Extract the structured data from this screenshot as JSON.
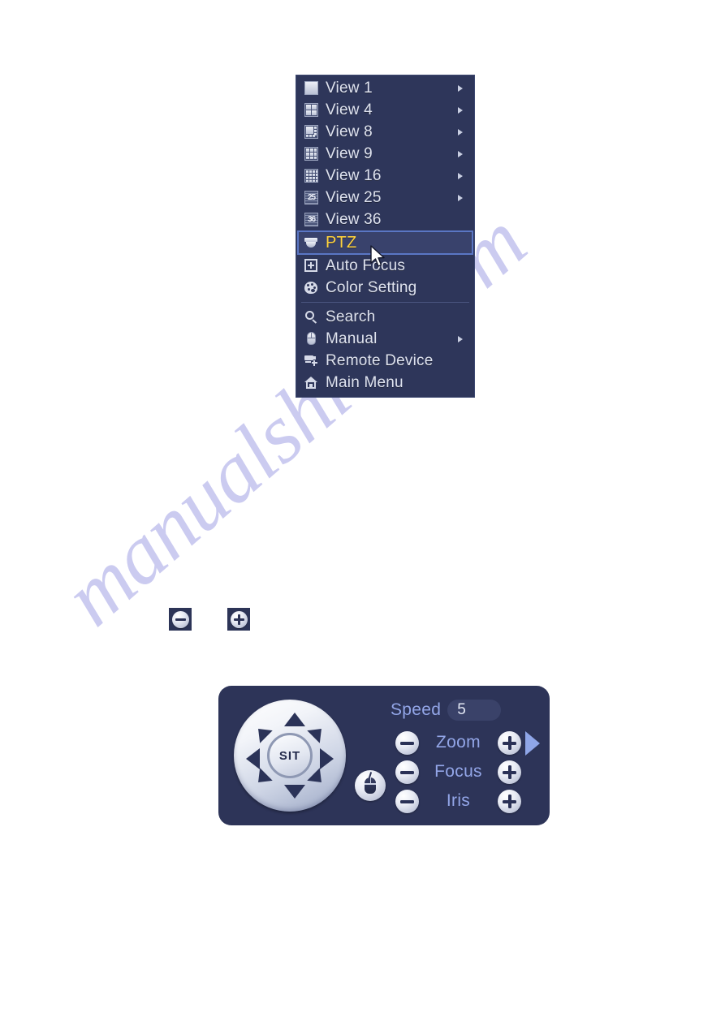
{
  "watermark": {
    "text": "manualshive.com"
  },
  "context_menu": {
    "view_items": [
      {
        "label": "View 1",
        "icon": "grid-1-icon",
        "has_submenu": true
      },
      {
        "label": "View 4",
        "icon": "grid-4-icon",
        "has_submenu": true
      },
      {
        "label": "View 8",
        "icon": "grid-8-icon",
        "has_submenu": true
      },
      {
        "label": "View 9",
        "icon": "grid-9-icon",
        "has_submenu": true
      },
      {
        "label": "View 16",
        "icon": "grid-16-icon",
        "has_submenu": true
      },
      {
        "label": "View 25",
        "icon": "grid-25-icon",
        "has_submenu": true
      },
      {
        "label": "View 36",
        "icon": "grid-36-icon",
        "has_submenu": false
      }
    ],
    "ptz_item": {
      "label": "PTZ",
      "icon": "dome-camera-icon",
      "selected": true
    },
    "mid_items": [
      {
        "label": "Auto Focus",
        "icon": "auto-focus-icon"
      },
      {
        "label": "Color Setting",
        "icon": "color-palette-icon"
      }
    ],
    "bottom_items": [
      {
        "label": "Search",
        "icon": "search-icon",
        "has_submenu": false
      },
      {
        "label": "Manual",
        "icon": "mouse-icon",
        "has_submenu": true
      },
      {
        "label": "Remote Device",
        "icon": "remote-device-icon",
        "has_submenu": false
      },
      {
        "label": "Main Menu",
        "icon": "home-icon",
        "has_submenu": false
      }
    ],
    "colors": {
      "background": "#2e365a",
      "text": "#dfe3ef",
      "selected_text": "#ffd23c",
      "selected_border": "#5a76c4",
      "selected_bg": "#39426c"
    }
  },
  "standalone_buttons": [
    {
      "name": "minus-button",
      "symbol": "minus"
    },
    {
      "name": "plus-button",
      "symbol": "plus"
    }
  ],
  "ptz_panel": {
    "joystick": {
      "center_label": "SIT"
    },
    "speed": {
      "label": "Speed",
      "value": "5"
    },
    "controls": [
      {
        "label": "Zoom",
        "minus": "-",
        "plus": "+"
      },
      {
        "label": "Focus",
        "minus": "-",
        "plus": "+"
      },
      {
        "label": "Iris",
        "minus": "-",
        "plus": "+"
      }
    ],
    "mouse_button_icon": "mouse-icon",
    "expand_button_icon": "chevron-right-icon",
    "colors": {
      "panel_bg": "#2d3458",
      "label_text": "#93a6e8",
      "value_text": "#e3e8f5",
      "speed_box_bg": "#3a4269",
      "expand_arrow": "#8fa6e8"
    }
  }
}
